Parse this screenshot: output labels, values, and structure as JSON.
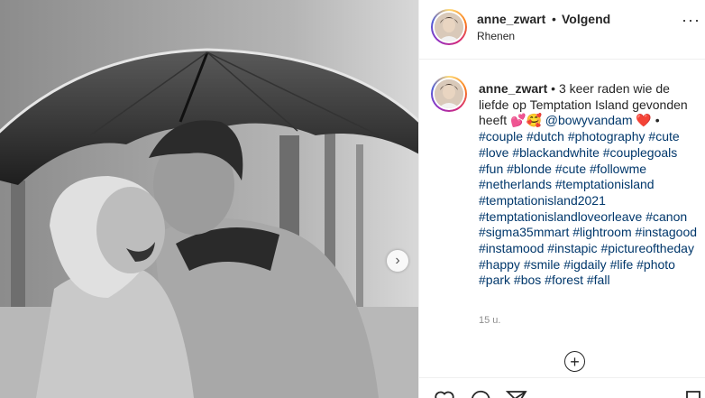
{
  "post": {
    "username": "anne_zwart",
    "separator": "•",
    "follow_status": "Volgend",
    "location": "Rhenen",
    "more_label": "···"
  },
  "caption": {
    "username": "anne_zwart",
    "separator": "•",
    "text": "3 keer raden wie de liefde op Temptation Island gevonden heeft",
    "emoji": "💕🥰",
    "mention": "@bowyvandam",
    "heart": "❤️",
    "bullet": "•",
    "hashtags": [
      "#couple",
      "#dutch",
      "#photography",
      "#cute",
      "#love",
      "#blackandwhite",
      "#couplegoals",
      "#fun",
      "#blonde",
      "#cute",
      "#followme",
      "#netherlands",
      "#temptationisland",
      "#temptationisland2021",
      "#temptationislandloveorleave",
      "#canon",
      "#sigma35mmart",
      "#lightroom",
      "#instagood",
      "#instamood",
      "#instapic",
      "#pictureoftheday",
      "#happy",
      "#smile",
      "#igdaily",
      "#life",
      "#photo",
      "#park",
      "#bos",
      "#forest",
      "#fall"
    ]
  },
  "timestamp": "15 u.",
  "load_more_label": "+",
  "next_label": "›"
}
